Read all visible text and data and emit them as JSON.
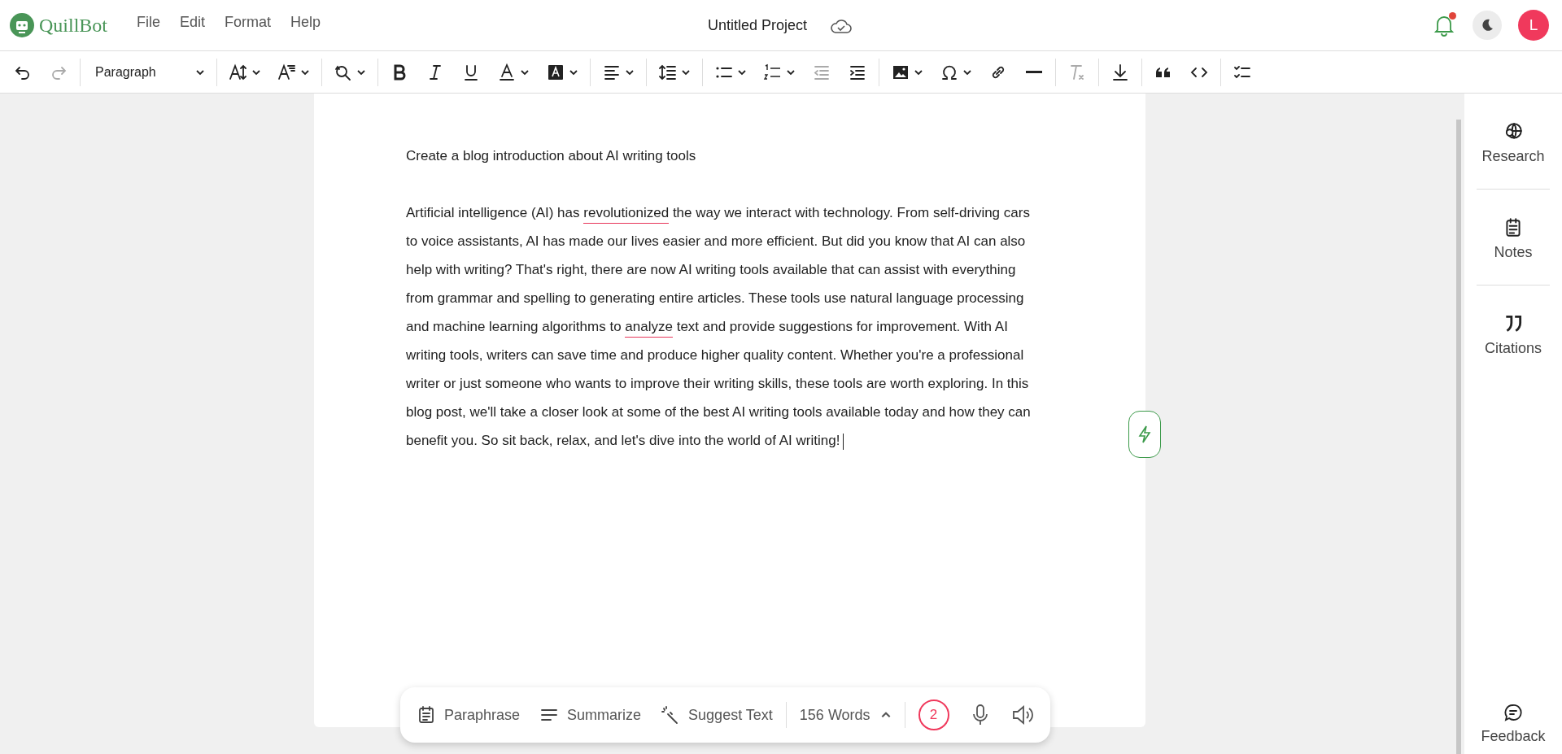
{
  "app": {
    "logo_text": "QuillBot",
    "menu": [
      "File",
      "Edit",
      "Format",
      "Help"
    ],
    "title": "Untitled Project",
    "notifications_unread": true,
    "avatar_letter": "L"
  },
  "toolbar": {
    "groups": [
      [
        {
          "kind": "undo",
          "disabled": false
        },
        {
          "kind": "redo",
          "disabled": true
        }
      ],
      [
        {
          "kind": "block-style",
          "label": "Paragraph",
          "disabled": false,
          "dropdown": true
        }
      ],
      [
        {
          "kind": "font-size",
          "disabled": false,
          "dropdown": true
        },
        {
          "kind": "font-style",
          "disabled": false,
          "dropdown": true
        }
      ],
      [
        {
          "kind": "find",
          "disabled": false,
          "dropdown": true
        }
      ],
      [
        {
          "kind": "bold",
          "disabled": false
        },
        {
          "kind": "italic",
          "disabled": false
        },
        {
          "kind": "underline",
          "disabled": false
        },
        {
          "kind": "text-color",
          "disabled": false,
          "dropdown": true
        },
        {
          "kind": "highlight",
          "disabled": false,
          "dropdown": true
        }
      ],
      [
        {
          "kind": "align",
          "disabled": false,
          "dropdown": true
        }
      ],
      [
        {
          "kind": "line-height",
          "disabled": false,
          "dropdown": true
        }
      ],
      [
        {
          "kind": "bullets",
          "disabled": false,
          "dropdown": true
        },
        {
          "kind": "numbers",
          "disabled": false,
          "dropdown": true
        },
        {
          "kind": "outdent",
          "disabled": true
        },
        {
          "kind": "indent",
          "disabled": false
        }
      ],
      [
        {
          "kind": "image",
          "disabled": false,
          "dropdown": true
        },
        {
          "kind": "symbol",
          "disabled": false,
          "dropdown": true
        },
        {
          "kind": "link",
          "disabled": false
        },
        {
          "kind": "rule",
          "disabled": false
        }
      ],
      [
        {
          "kind": "clear-format",
          "disabled": true
        }
      ],
      [
        {
          "kind": "download",
          "disabled": false
        }
      ],
      [
        {
          "kind": "quote",
          "disabled": false
        },
        {
          "kind": "code",
          "disabled": false
        }
      ],
      [
        {
          "kind": "checklist",
          "disabled": false
        }
      ]
    ]
  },
  "document": {
    "heading": "Create a blog introduction about AI writing tools",
    "paragraph": [
      {
        "text": "Artificial intelligence (AI) has ",
        "flagged": false
      },
      {
        "text": "revolutionized",
        "flagged": true
      },
      {
        "text": " the way we interact with technology. From self-driving cars to voice assistants, AI has made our lives easier and more efficient. But did you know that AI can also help with writing? That's right, there are now AI writing tools available that can assist with everything from grammar and spelling to generating entire articles. These tools use natural language processing and machine learning algorithms to ",
        "flagged": false
      },
      {
        "text": "analyze",
        "flagged": true
      },
      {
        "text": " text and provide suggestions for improvement. With AI writing tools, writers can save time and produce higher quality content. Whether you're a professional writer or just someone who wants to improve their writing skills, these tools are worth exploring. In this blog post, we'll take a closer look at some of the best AI writing tools available today and how they can benefit you. So sit back, relax, and let's dive into the world of AI writing!",
        "flagged": false
      }
    ]
  },
  "bottom_bar": {
    "actions": [
      {
        "kind": "paraphrase",
        "label": "Paraphrase"
      },
      {
        "kind": "summarize",
        "label": "Summarize"
      },
      {
        "kind": "suggest",
        "label": "Suggest Text"
      }
    ],
    "word_count": "156 Words",
    "issues": "2"
  },
  "sidebar": {
    "items": [
      {
        "kind": "research",
        "label": "Research"
      },
      {
        "kind": "notes",
        "label": "Notes"
      },
      {
        "kind": "citations",
        "label": "Citations"
      }
    ],
    "feedback": "Feedback"
  }
}
